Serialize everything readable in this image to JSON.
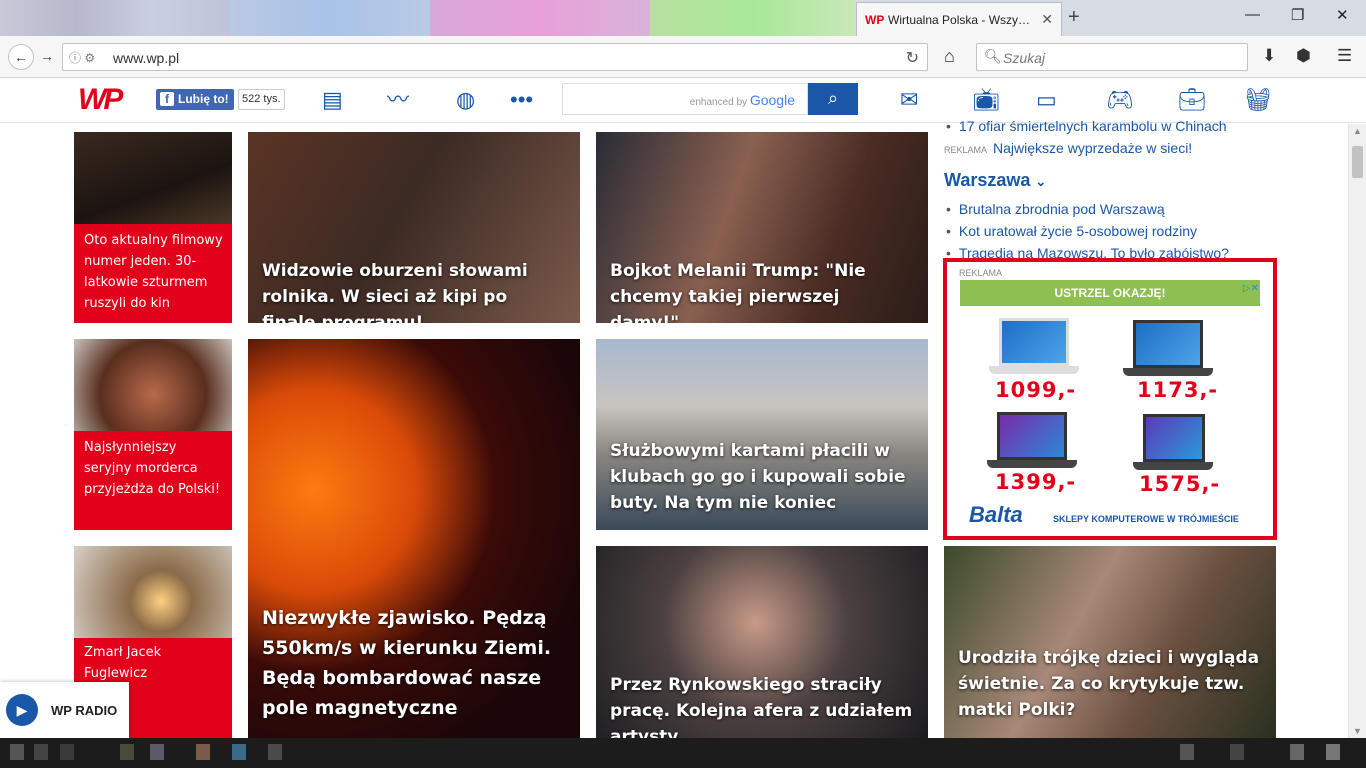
{
  "browser": {
    "active_tab_title": "Wirtualna Polska - Wszy…",
    "url": "www.wp.pl",
    "search_placeholder": "Szukaj"
  },
  "site": {
    "logo_text": "WP",
    "fb_like_label": "Lubię to!",
    "fb_like_count": "522 tys.",
    "search_enhanced_label": "enhanced by",
    "search_enhanced_brand": "Google"
  },
  "left_small_cards": [
    {
      "caption": "Oto aktualny filmowy numer jeden. 30-latkowie szturmem ruszyli do kin"
    },
    {
      "caption": "Najsłynniejszy seryjny morderca przyjeżdża do Polski!"
    },
    {
      "caption": "Zmarł Jacek Fuglewicz"
    }
  ],
  "main_cards": [
    {
      "caption": "Widzowie oburzeni słowami rolnika. W sieci aż kipi po finale programu!"
    },
    {
      "caption": "Bojkot Melanii Trump: \"Nie chcemy takiej pierwszej damy!\""
    },
    {
      "caption": "Niezwykłe zjawisko. Pędzą 550km/s w kierunku Ziemi. Będą bombardować nasze pole magnetyczne"
    },
    {
      "caption": "Służbowymi kartami płacili w klubach go go i kupowali sobie buty. Na tym nie koniec"
    },
    {
      "caption": "Przez Rynkowskiego straciły pracę. Kolejna afera z udziałem artysty"
    },
    {
      "caption": "Urodziła trójkę dzieci i wygląda świetnie. Za co krytykuje tzw. matki Polki?"
    }
  ],
  "right_column": {
    "top_link": "17 ofiar śmiertelnych karambolu w Chinach",
    "ad_tag": "REKLAMA",
    "ad_link": "Największe wyprzedaże w sieci!",
    "section_title": "Warszawa",
    "section_links": [
      "Brutalna zbrodnia pod Warszawą",
      "Kot uratował życie 5-osobowej rodziny",
      "Tragedia na Mazowszu. To było zabójstwo?"
    ]
  },
  "ad": {
    "tag": "REKLAMA",
    "banner": "USTRZEL OKAZJĘ!",
    "prices": [
      "1099,-",
      "1173,-",
      "1399,-",
      "1575,-"
    ],
    "brand": "Balta",
    "tagline": "SKLEPY KOMPUTEROWE W TRÓJMIEŚCIE"
  },
  "radio": {
    "label": "WP RADIO"
  },
  "colors": {
    "brand_red": "#e2001a",
    "brand_blue": "#1a57a8",
    "fb_blue": "#4267b2"
  }
}
